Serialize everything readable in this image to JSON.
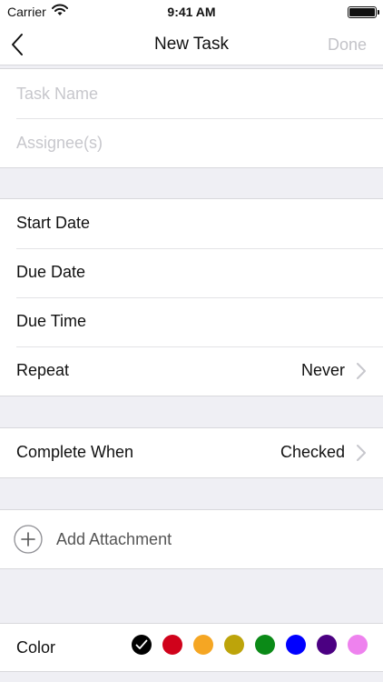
{
  "status_bar": {
    "carrier": "Carrier",
    "time": "9:41 AM",
    "battery_level": 1.0
  },
  "nav": {
    "title": "New Task",
    "done_label": "Done"
  },
  "inputs": {
    "task_name_placeholder": "Task Name",
    "assignee_placeholder": "Assignee(s)"
  },
  "schedule": {
    "start_date_label": "Start Date",
    "due_date_label": "Due Date",
    "due_time_label": "Due Time",
    "repeat_label": "Repeat",
    "repeat_value": "Never"
  },
  "completion": {
    "label": "Complete When",
    "value": "Checked"
  },
  "attachment": {
    "label": "Add Attachment"
  },
  "color": {
    "label": "Color",
    "selected_index": 0,
    "swatches": [
      {
        "name": "black",
        "hex": "#000000"
      },
      {
        "name": "red",
        "hex": "#d0021b"
      },
      {
        "name": "orange",
        "hex": "#f5a623"
      },
      {
        "name": "olive",
        "hex": "#bda40a"
      },
      {
        "name": "green",
        "hex": "#0b8a17"
      },
      {
        "name": "blue",
        "hex": "#0000ff"
      },
      {
        "name": "purple",
        "hex": "#4b0082"
      },
      {
        "name": "pink",
        "hex": "#ee82ee"
      }
    ]
  }
}
